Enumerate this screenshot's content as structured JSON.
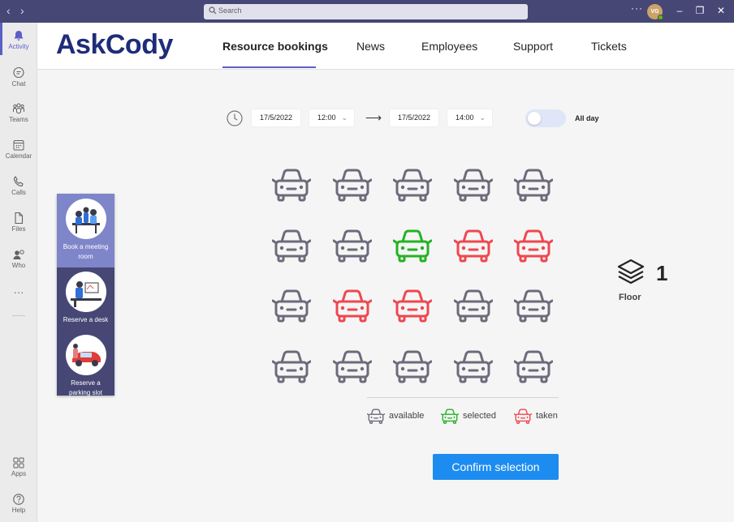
{
  "titlebar": {
    "search_placeholder": "Search",
    "more": "···",
    "avatar_initials": "VG"
  },
  "rail": {
    "items": [
      {
        "label": "Activity",
        "icon": "bell-icon"
      },
      {
        "label": "Chat",
        "icon": "chat-icon"
      },
      {
        "label": "Teams",
        "icon": "teams-icon"
      },
      {
        "label": "Calendar",
        "icon": "calendar-icon"
      },
      {
        "label": "Calls",
        "icon": "phone-icon"
      },
      {
        "label": "Files",
        "icon": "file-icon"
      },
      {
        "label": "Who",
        "icon": "who-icon"
      }
    ],
    "more": "···",
    "apps_label": "Apps",
    "help_label": "Help"
  },
  "app": {
    "logo": "AskCody",
    "tabs": [
      "Resource bookings",
      "News",
      "Employees",
      "Support",
      "Tickets"
    ],
    "active_tab": "Resource bookings"
  },
  "booking": {
    "start_date": "17/5/2022",
    "start_time": "12:00",
    "end_date": "17/5/2022",
    "end_time": "14:00",
    "all_day_label": "All day",
    "all_day": false
  },
  "side_menu": [
    {
      "label": "Book a meeting room",
      "active": true
    },
    {
      "label": "Reserve a desk",
      "active": false
    },
    {
      "label": "Reserve a parking slot",
      "active": false
    }
  ],
  "parking": {
    "colors": {
      "available": "#6b6b7b",
      "selected": "#22b322",
      "taken": "#f0474f"
    },
    "rows": [
      [
        "available",
        "available",
        "available",
        "available",
        "available"
      ],
      [
        "available",
        "available",
        "selected",
        "taken",
        "taken"
      ],
      [
        "available",
        "taken",
        "taken",
        "available",
        "available"
      ],
      [
        "available",
        "available",
        "available",
        "available",
        "available"
      ]
    ],
    "legend": [
      {
        "key": "available",
        "label": "available"
      },
      {
        "key": "selected",
        "label": "selected"
      },
      {
        "key": "taken",
        "label": "taken"
      }
    ]
  },
  "floor": {
    "number": "1",
    "label": "Floor"
  },
  "confirm_label": "Confirm selection"
}
